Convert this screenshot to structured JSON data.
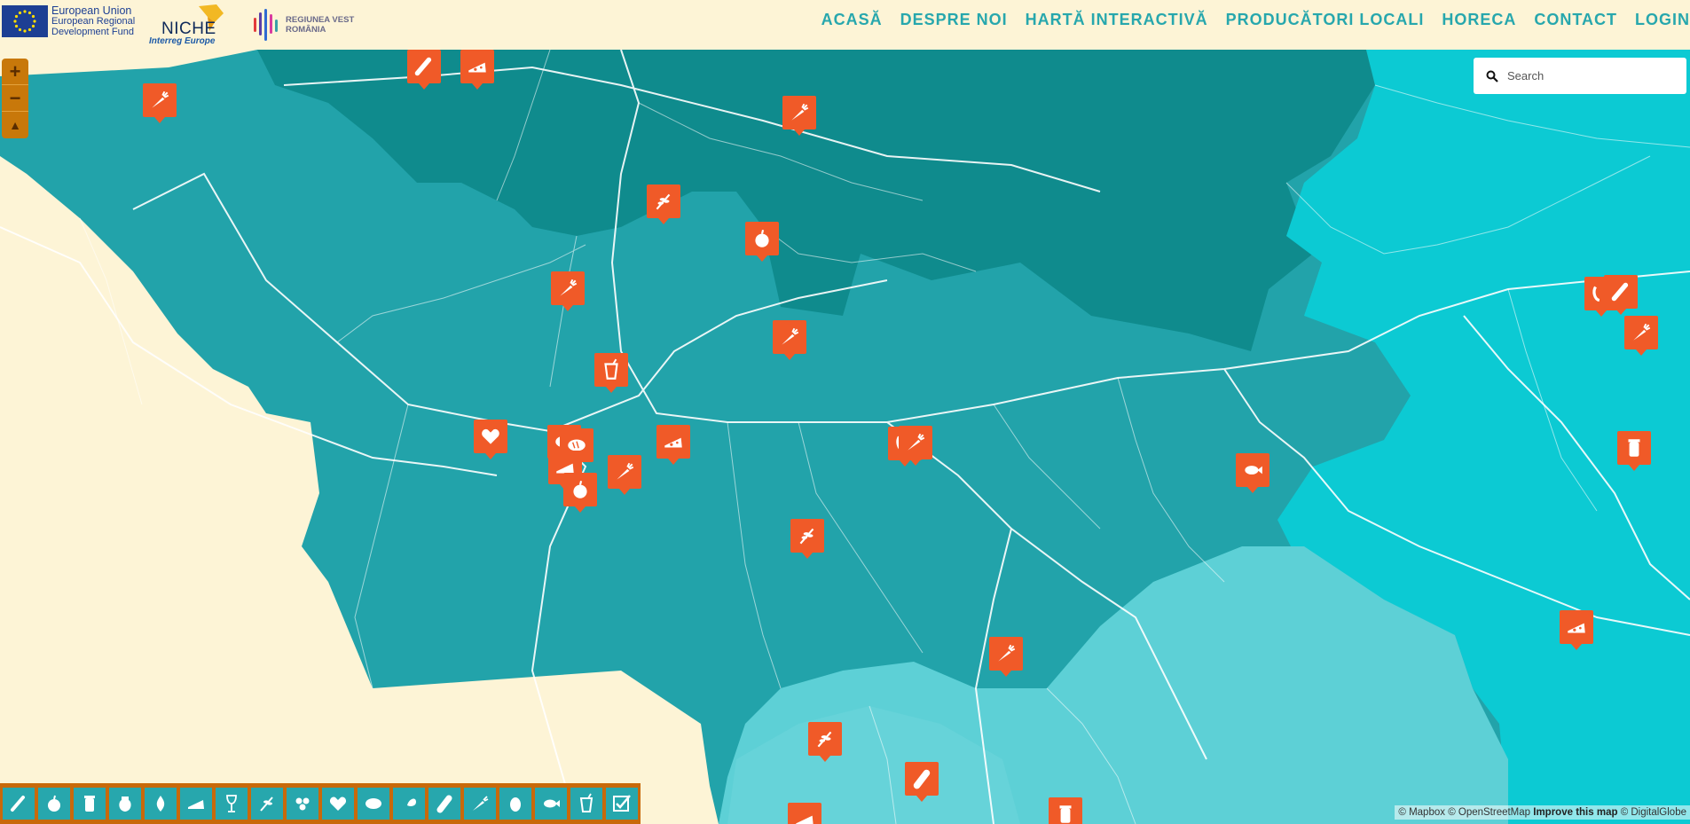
{
  "header": {
    "eu_logo": {
      "line1": "European Union",
      "line2": "European Regional",
      "line3": "Development Fund"
    },
    "niche_logo": {
      "word": "NICHE",
      "sub": "Interreg Europe"
    },
    "rv_logo": {
      "line1": "REGIUNEA VEST",
      "line2": "ROMÂNIA"
    },
    "nav": [
      "ACASĂ",
      "DESPRE NOI",
      "HARTĂ INTERACTIVĂ",
      "PRODUCĂTORI LOCALI",
      "HORECA",
      "CONTACT",
      "LOGIN"
    ]
  },
  "map": {
    "zoom_in": "+",
    "zoom_out": "−",
    "compass": "▲",
    "search": {
      "placeholder": "Search",
      "value": ""
    },
    "attribution": {
      "mapbox": "© Mapbox",
      "osm": "© OpenStreetMap",
      "improve": "Improve this map",
      "digitalglobe": "© DigitalGlobe"
    },
    "colors": {
      "region_dark": "#0f8b8d",
      "region_mid": "#22a3aa",
      "region_light": "#5dd0d6",
      "region_cyan": "#0ccad3",
      "pin": "#f05a28",
      "filter_bar": "#c8690a",
      "filter_btn": "#27a7ad"
    },
    "pins": [
      {
        "icon": "carrot-icon"
      },
      {
        "icon": "sausage-icon"
      },
      {
        "icon": "cheese-icon"
      },
      {
        "icon": "carrot-icon"
      },
      {
        "icon": "herb-icon"
      },
      {
        "icon": "apple-icon"
      },
      {
        "icon": "carrot-icon"
      },
      {
        "icon": "carrot-icon"
      },
      {
        "icon": "juice-icon"
      },
      {
        "icon": "heart-icon"
      },
      {
        "icon": "bread-icon"
      },
      {
        "icon": "carrot-icon"
      },
      {
        "icon": "apple-icon"
      },
      {
        "icon": "cheese-icon"
      },
      {
        "icon": "carrot-icon"
      },
      {
        "icon": "herb-icon"
      },
      {
        "icon": "fish-icon"
      },
      {
        "icon": "carrot-icon"
      },
      {
        "icon": "herb-icon"
      },
      {
        "icon": "salami-icon"
      },
      {
        "icon": "jar-icon"
      },
      {
        "icon": "sausage-icon"
      },
      {
        "icon": "carrot-icon"
      },
      {
        "icon": "jar-icon"
      },
      {
        "icon": "cheese-icon"
      }
    ]
  },
  "filters": [
    {
      "icon": "sausage-icon"
    },
    {
      "icon": "apple-icon"
    },
    {
      "icon": "jar-icon"
    },
    {
      "icon": "honey-pot-icon"
    },
    {
      "icon": "oil-drop-icon"
    },
    {
      "icon": "cheese-icon"
    },
    {
      "icon": "wine-glass-icon"
    },
    {
      "icon": "herb-icon"
    },
    {
      "icon": "honeycomb-icon"
    },
    {
      "icon": "heart-icon"
    },
    {
      "icon": "bread-icon"
    },
    {
      "icon": "ham-icon"
    },
    {
      "icon": "salami-icon"
    },
    {
      "icon": "carrot-icon"
    },
    {
      "icon": "egg-icon"
    },
    {
      "icon": "fish-icon"
    },
    {
      "icon": "juice-icon"
    },
    {
      "icon": "check-all-icon"
    }
  ]
}
